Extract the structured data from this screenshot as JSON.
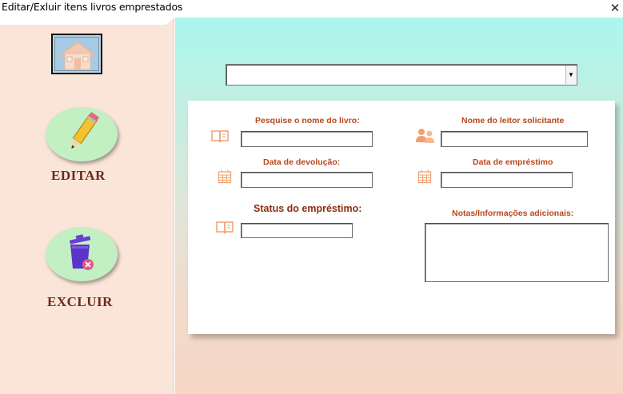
{
  "window": {
    "title": "Editar/Exluir itens livros emprestados",
    "close_glyph": "✕"
  },
  "sidebar": {
    "home_icon": "house-icon",
    "edit_label": "EDITAR",
    "edit_icon": "pencil-icon",
    "delete_label": "EXCLUIR",
    "delete_icon": "trash-delete-icon"
  },
  "top_combo": {
    "value": "",
    "arrow_glyph": "▼"
  },
  "form": {
    "book_search_label": "Pesquise o nome do livro:",
    "book_search_value": "",
    "reader_label": "Nome do leitor solicitante",
    "reader_value": "",
    "return_date_label": "Data de devolução:",
    "return_date_value": "",
    "loan_date_label": "Data de empréstimo",
    "loan_date_value": "",
    "status_label": "Status do empréstimo:",
    "status_value": "",
    "notes_label": "Notas/Informações adicionais:",
    "notes_value": ""
  },
  "colors": {
    "accent_label": "#b9471a",
    "sidebar_bg": "#fae5d8",
    "action_oval": "#c3f0c3",
    "action_text": "#6b2a1c",
    "icon_orange": "#f0a070"
  }
}
